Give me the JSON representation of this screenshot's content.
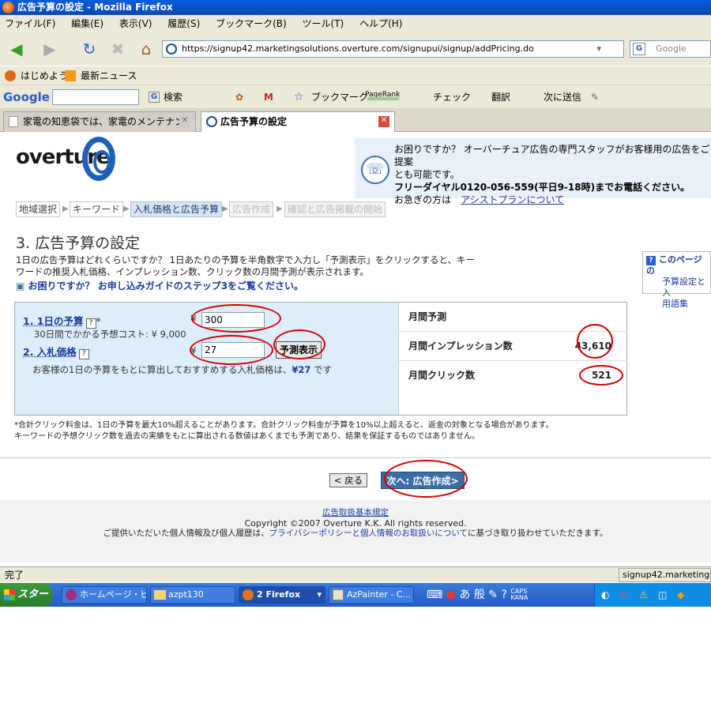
{
  "window": {
    "title": "広告予算の設定 - Mozilla Firefox"
  },
  "menu": [
    "ファイル(F)",
    "編集(E)",
    "表示(V)",
    "履歴(S)",
    "ブックマーク(B)",
    "ツール(T)",
    "ヘルプ(H)"
  ],
  "nav": {
    "url": "https://signup42.marketingsolutions.overture.com/signupui/signup/addPricing.do",
    "search_placeholder": "Google"
  },
  "bookmarks": [
    "はじめよう",
    "最新ニュース"
  ],
  "google_toolbar": {
    "logo": "Google",
    "search": "検索",
    "pagerank": "PageRank",
    "bookmarks": "ブックマーク",
    "check": "チェック",
    "translate": "翻訳",
    "send": "次に送信"
  },
  "tabs": [
    {
      "label": "家電の知恵袋では、家電のメンテナンス...",
      "active": false
    },
    {
      "label": "広告予算の設定",
      "active": true
    }
  ],
  "page": {
    "logo": "overture",
    "help": {
      "line1": "お困りですか？ オーバーチュア広告の専門スタッフがお客様用の広告をご提案",
      "line2": "とも可能です。",
      "line3": "フリーダイヤル0120-056-559(平日9-18時)までお電話ください。",
      "line4_prefix": "お急ぎの方は",
      "line4_link": "アシストプランについて"
    },
    "steps": [
      "地域選択",
      "キーワード",
      "入札価格と広告予算",
      "広告作成",
      "確認と広告掲載の開始"
    ],
    "heading": "3. 広告予算の設定",
    "intro": "1日の広告予算はどれくらいですか？ 1日あたりの予算を半角数字で入力し「予測表示」をクリックすると、キーワードの推奨入札価格、インプレッション数、クリック数の月間予測が表示されます。",
    "guide_link": "お困りですか？ お申し込みガイドのステップ3をご覧ください。",
    "side_help": {
      "title": "このページの",
      "l1": "予算設定と入",
      "l2": "用語集"
    },
    "form": {
      "budget_label": "1. 1日の予算",
      "budget_value": "300",
      "budget_note": "30日間でかかる予想コスト:  ¥ 9,000",
      "bid_label": "2. 入札価格",
      "bid_value": "27",
      "predict_button": "予測表示",
      "recommend_note": "お客様の1日の予算をもとに算出しておすすめする入札価格は、",
      "recommend_value": "¥27",
      "recommend_suffix": "です",
      "yen": "¥",
      "q": "?",
      "star": "*"
    },
    "forecast": {
      "header": "月間予測",
      "impressions_label": "月間インプレッション数",
      "impressions_value": "43,610",
      "clicks_label": "月間クリック数",
      "clicks_value": "521"
    },
    "disclaimer1": "*合計クリック料金は、1日の予算を最大10%超えることがあります。合計クリック料金が予算を10%以上超えると、返金の対象となる場合があります。",
    "disclaimer2": "キーワードの予想クリック数を過去の実績をもとに算出される数値はあくまでも予測であり、結果を保証するものではありません。",
    "back_button": "< 戻る",
    "next_button": "次へ: 広告作成>",
    "footer": {
      "terms": "広告取扱基本規定",
      "copyright": "Copyright ©2007 Overture K.K. All rights reserved.",
      "privacy_prefix": "ご提供いただいた個人情報及び個人履歴は、",
      "privacy_link": "プライバシーポリシーと個人情報のお取扱いについて",
      "privacy_suffix": "に基づき取り扱わせていただきます。"
    }
  },
  "status": {
    "text": "完了",
    "domain": "signup42.marketingsolutions"
  },
  "taskbar": {
    "start": "スタート",
    "tasks": [
      "ホームページ・ビ...",
      "azpt130",
      "2 Firefox",
      "AzPainter - C..."
    ],
    "ime": "あ 般",
    "caps": "CAPS",
    "kana": "KANA"
  }
}
